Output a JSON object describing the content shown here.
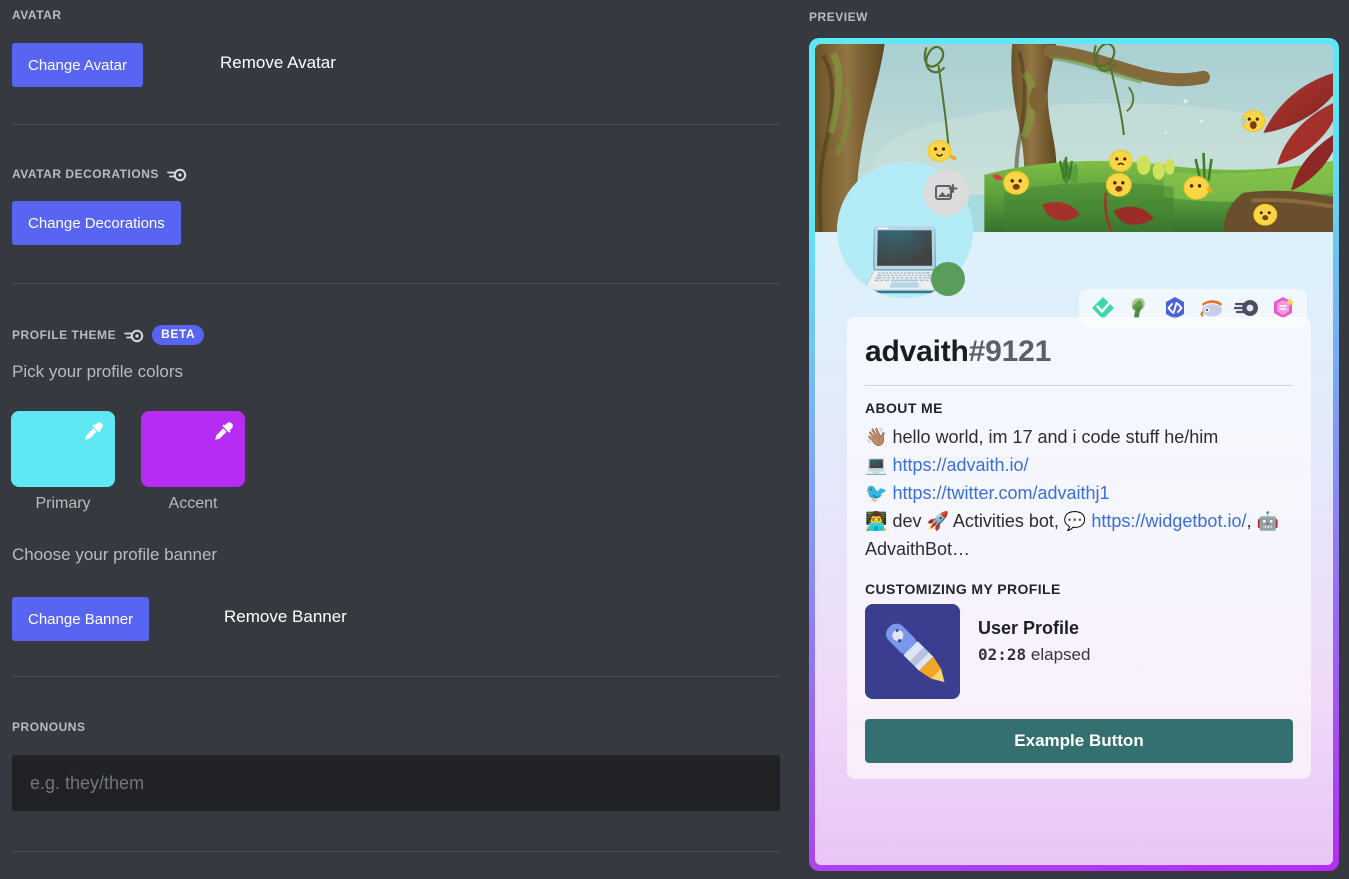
{
  "settings": {
    "avatar": {
      "header": "AVATAR",
      "change_label": "Change Avatar",
      "remove_label": "Remove Avatar"
    },
    "decorations": {
      "header": "AVATAR DECORATIONS",
      "new_icon": "new-feature-icon",
      "change_label": "Change Decorations"
    },
    "profile_theme": {
      "header": "PROFILE THEME",
      "new_icon": "new-feature-icon",
      "beta_label": "BETA",
      "colors_prompt": "Pick your profile colors",
      "swatches": [
        {
          "label": "Primary",
          "color": "#5DE8F4",
          "icon": "eyedropper-icon"
        },
        {
          "label": "Accent",
          "color": "#B62CF2",
          "icon": "eyedropper-icon"
        }
      ],
      "banner_prompt": "Choose your profile banner",
      "change_banner_label": "Change Banner",
      "remove_banner_label": "Remove Banner"
    },
    "pronouns": {
      "header": "PRONOUNS",
      "value": "",
      "placeholder": "e.g. they/them"
    }
  },
  "preview": {
    "label": "PREVIEW",
    "card_border_from": "#5DE8F4",
    "card_border_to": "#B62CF2",
    "banner": {
      "name": "jungle-banner-image",
      "description": "Illustrated jungle scene with mossy trees, hanging vines, grass, red leaves and yellow chick characters"
    },
    "avatar": {
      "emoji": "💻",
      "face_emoji": "🤔",
      "background": "#B3ECF7",
      "camera_icon": "add-image-icon",
      "status": "online",
      "status_color": "#5A9D5A"
    },
    "badges": [
      {
        "name": "hypesquad-balance-badge",
        "glyph": "◈",
        "color": "#3fd6a8"
      },
      {
        "name": "early-supporter-badge",
        "glyph": "♁",
        "color": "#6fa86f"
      },
      {
        "name": "active-developer-badge",
        "glyph": "‹›",
        "color": "#4a63d8"
      },
      {
        "name": "bot-developer-badge",
        "glyph": "◔",
        "color": "#c9d2e8"
      },
      {
        "name": "nitro-boost-badge",
        "glyph": "◎",
        "color": "#4c4f63"
      },
      {
        "name": "server-boost-badge",
        "glyph": "⬢",
        "color": "#e85ad0"
      }
    ],
    "profile": {
      "username": "advaith",
      "discriminator": "#9121",
      "about_header": "ABOUT ME",
      "about_lines": [
        {
          "emoji": "👋🏽",
          "text": "hello world, im 17 and i code stuff he/him"
        },
        {
          "emoji": "💻",
          "link": "https://advaith.io/"
        },
        {
          "emoji": "🐦",
          "link": "https://twitter.com/advaithj1"
        },
        {
          "emoji": "👨‍💻",
          "text": "dev 🚀 Activities bot, 💬",
          "link": "https://widgetbot.io/",
          "tail": ", 🤖 AdvaithBot…"
        }
      ],
      "activity_header": "CUSTOMIZING MY PROFILE",
      "activity": {
        "art_icon": "rocket-pencil-art",
        "art_emoji": "🚀",
        "name": "User Profile",
        "elapsed_time": "02:28",
        "elapsed_label": "elapsed"
      },
      "example_button_label": "Example Button",
      "example_button_color": "#33706F"
    }
  }
}
